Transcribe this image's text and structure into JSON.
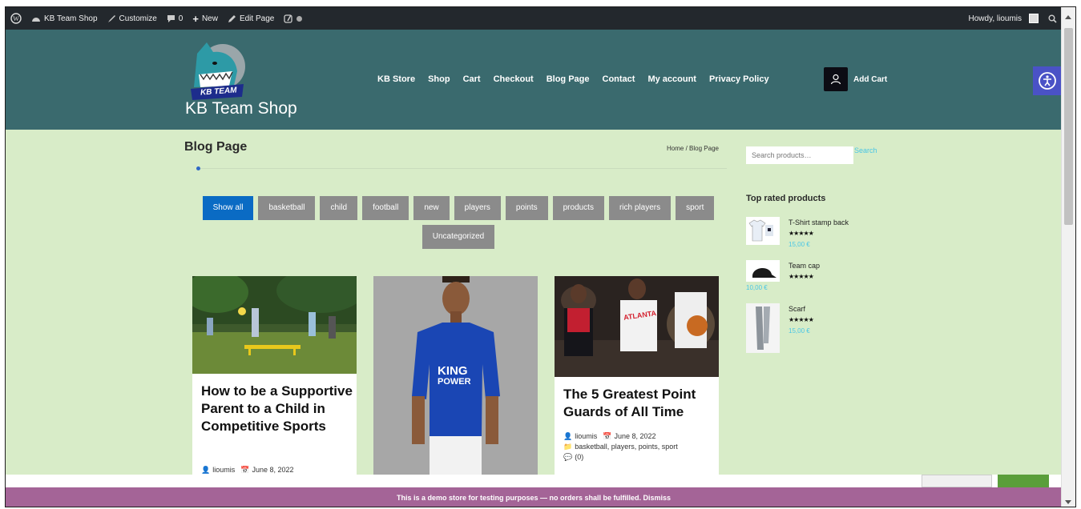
{
  "admin_bar": {
    "site_name": "KB Team Shop",
    "customize": "Customize",
    "comments_count": "0",
    "new_label": "New",
    "edit_page": "Edit Page",
    "howdy": "Howdy, lioumis"
  },
  "header": {
    "site_title": "KB Team Shop",
    "logo_text": "KB TEAM",
    "nav": [
      "KB Store",
      "Shop",
      "Cart",
      "Checkout",
      "Blog Page",
      "Contact",
      "My account",
      "Privacy Policy"
    ],
    "cart_label": "Add Cart"
  },
  "main": {
    "page_title": "Blog Page",
    "breadcrumb": {
      "home": "Home",
      "separator": "/",
      "current": "Blog Page"
    },
    "filters": [
      "Show all",
      "basketball",
      "child",
      "football",
      "new",
      "players",
      "points",
      "products",
      "rich players",
      "sport",
      "Uncategorized"
    ],
    "active_filter": "Show all",
    "posts": [
      {
        "title": "How to be a Supportive Parent to a Child in Competitive Sports",
        "author": "lioumis",
        "date": "June 8, 2022"
      },
      {
        "jersey_text_1": "KING",
        "jersey_text_2": "POWER"
      },
      {
        "title": "The 5 Greatest Point Guards of All Time",
        "author": "lioumis",
        "date": "June 8, 2022",
        "categories": "basketball, players, points, sport",
        "comments": "(0)",
        "jersey_text": "ATLANTA"
      }
    ]
  },
  "sidebar": {
    "search_placeholder": "Search products…",
    "search_button": "Search",
    "widget_title": "Top rated products",
    "products": [
      {
        "name": "T-Shirt stamp back",
        "stars": "★★★★★",
        "price": "15,00 €"
      },
      {
        "name": "Team cap",
        "stars": "★★★★★",
        "price": "10,00 €"
      },
      {
        "name": "Scarf",
        "stars": "★★★★★",
        "price": "15,00 €"
      }
    ]
  },
  "demo_notice": "This is a demo store for testing purposes — no orders shall be fulfilled. Dismiss",
  "colors": {
    "header_bg": "#3a6a6e",
    "page_bg": "#d8ecc8",
    "active_filter": "#0a6bc4",
    "filter": "#8b8b8b",
    "demo_bar": "#a46497",
    "price": "#49c6e5"
  }
}
